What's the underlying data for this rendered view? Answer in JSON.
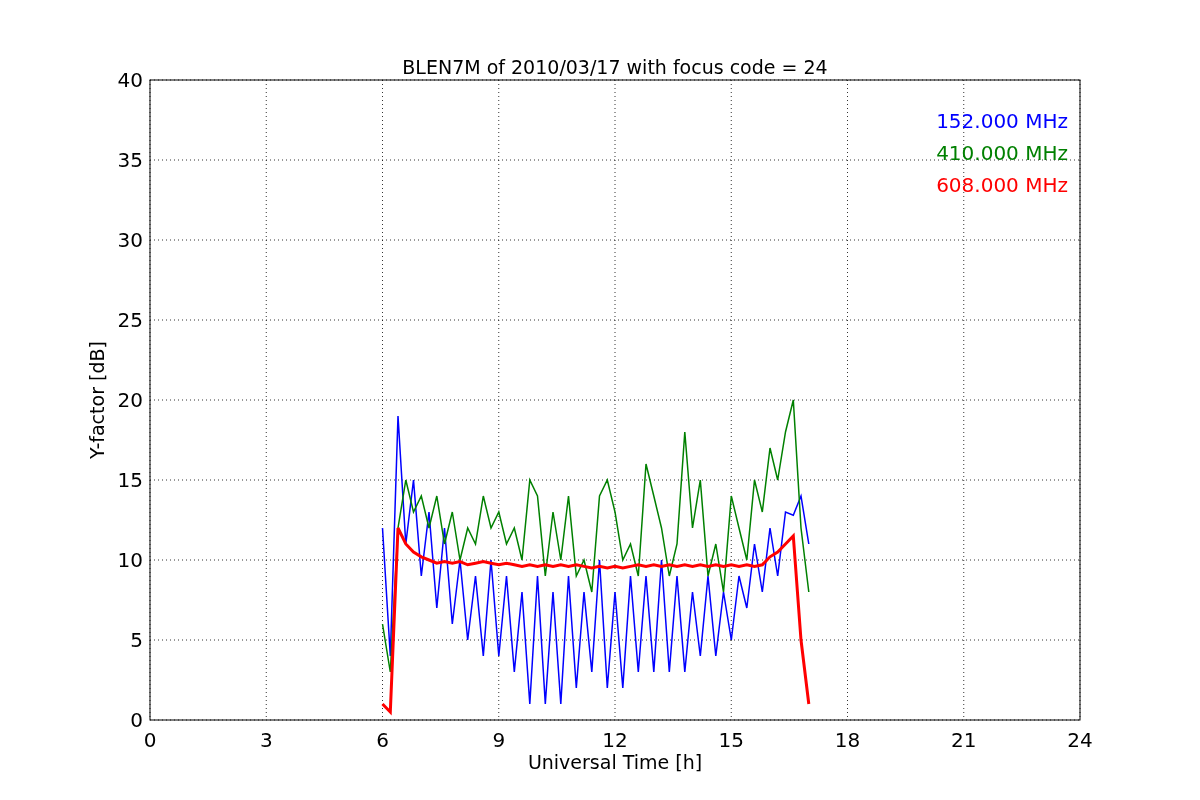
{
  "figure": {
    "chart_data": {
      "type": "line",
      "title": "BLEN7M of 2010/03/17 with focus code = 24",
      "xlabel": "Universal Time [h]",
      "ylabel": "Y-factor [dB]",
      "x": [
        6.0,
        6.2,
        6.4,
        6.6,
        6.8,
        7.0,
        7.2,
        7.4,
        7.6,
        7.8,
        8.0,
        8.2,
        8.4,
        8.6,
        8.8,
        9.0,
        9.2,
        9.4,
        9.6,
        9.8,
        10.0,
        10.2,
        10.4,
        10.6,
        10.8,
        11.0,
        11.2,
        11.4,
        11.6,
        11.8,
        12.0,
        12.2,
        12.4,
        12.6,
        12.8,
        13.0,
        13.2,
        13.4,
        13.6,
        13.8,
        14.0,
        14.2,
        14.4,
        14.6,
        14.8,
        15.0,
        15.2,
        15.4,
        15.6,
        15.8,
        16.0,
        16.2,
        16.4,
        16.6,
        16.8,
        17.0
      ],
      "series": [
        {
          "name": "152.000 MHz",
          "color": "#0000ff",
          "values": [
            12,
            4,
            19,
            11,
            15,
            9,
            13,
            7,
            12,
            6,
            10,
            5,
            9,
            4,
            10,
            4,
            9,
            3,
            8,
            1,
            9,
            1,
            8,
            1,
            9,
            2,
            8,
            3,
            10,
            2,
            8,
            2,
            9,
            3,
            9,
            3,
            10,
            3,
            9,
            3,
            8,
            4,
            9,
            4,
            8,
            5,
            9,
            7,
            11,
            8,
            12,
            9,
            13,
            12.8,
            14,
            11
          ]
        },
        {
          "name": "410.000 MHz",
          "color": "#008000",
          "values": [
            6,
            3,
            12,
            15,
            13,
            14,
            12,
            14,
            11,
            13,
            10,
            12,
            11,
            14,
            12,
            13,
            11,
            12,
            10,
            15,
            14,
            9,
            13,
            10,
            14,
            9,
            10,
            8,
            14,
            15,
            13,
            10,
            11,
            9,
            16,
            14,
            12,
            9,
            11,
            18,
            12,
            15,
            9,
            11,
            8,
            14,
            12,
            10,
            15,
            13,
            17,
            15,
            18,
            20,
            12,
            8
          ]
        },
        {
          "name": "608.000 MHz",
          "color": "#ff0000",
          "values": [
            1,
            0.5,
            12,
            11,
            10.5,
            10.2,
            10,
            9.8,
            9.9,
            9.8,
            9.9,
            9.7,
            9.8,
            9.9,
            9.8,
            9.7,
            9.8,
            9.7,
            9.6,
            9.7,
            9.6,
            9.7,
            9.6,
            9.7,
            9.6,
            9.7,
            9.6,
            9.5,
            9.6,
            9.5,
            9.6,
            9.5,
            9.6,
            9.7,
            9.6,
            9.7,
            9.6,
            9.7,
            9.6,
            9.7,
            9.6,
            9.7,
            9.6,
            9.7,
            9.6,
            9.7,
            9.6,
            9.7,
            9.6,
            9.7,
            10.2,
            10.5,
            11,
            11.5,
            5,
            1
          ]
        }
      ],
      "grid": true,
      "xlim": [
        0,
        24
      ],
      "ylim": [
        0,
        40
      ],
      "xticks": [
        0,
        3,
        6,
        9,
        12,
        15,
        18,
        21,
        24
      ],
      "yticks": [
        0,
        5,
        10,
        15,
        20,
        25,
        30,
        35,
        40
      ]
    }
  }
}
